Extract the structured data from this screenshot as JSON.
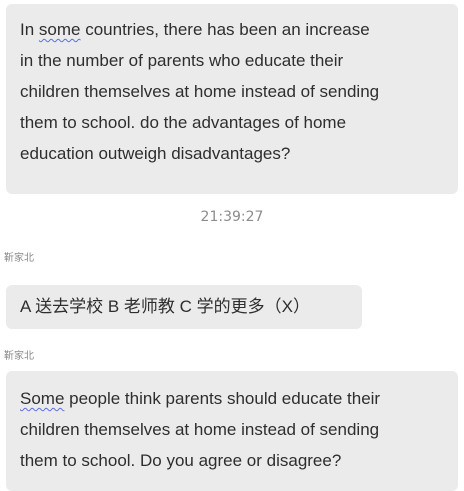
{
  "messages": [
    {
      "lead_word": "In",
      "squiggle_word": "some",
      "lines": [
        " countries, there has been an increase",
        "in the number of parents who educate their",
        "children themselves at home instead of sending",
        "them to school. do the advantages of home",
        "education outweigh disadvantages?"
      ]
    },
    {
      "sender": "靳家北",
      "text": "A 送去学校 B 老师教 C 学的更多（X）"
    },
    {
      "sender": "靳家北",
      "squiggle_word": "Some",
      "lines": [
        " people think parents should educate their",
        "children themselves at home instead of sending",
        "them to school. Do you agree or disagree?"
      ]
    }
  ],
  "timestamp": "21:39:27",
  "colors": {
    "bubble_bg": "#ebebeb",
    "spellcheck_underline": "#5a6ee0",
    "meta_text": "#8c8c8c"
  }
}
